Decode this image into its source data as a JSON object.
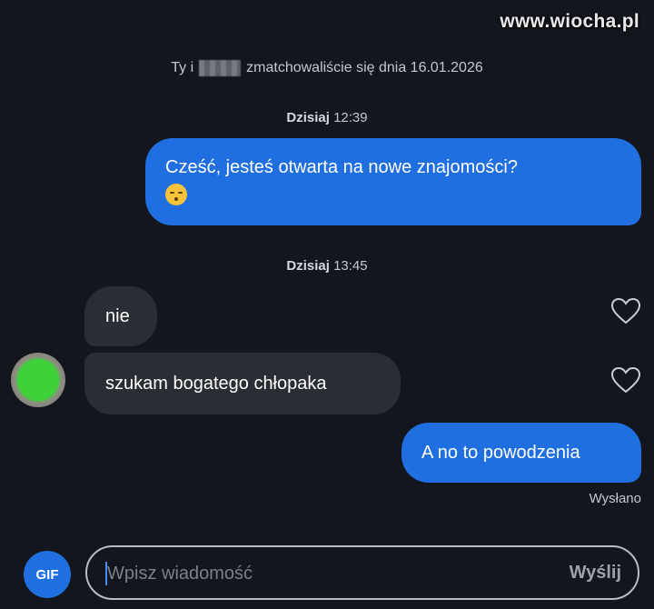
{
  "watermark": "www.wiocha.pl",
  "match_info": {
    "prefix": "Ty i",
    "suffix": "zmatchowaliście się dnia 16.01.2026"
  },
  "messages": [
    {
      "type": "timestamp",
      "day": "Dzisiaj",
      "time": "12:39"
    },
    {
      "type": "outgoing",
      "text": "Cześć, jesteś otwarta na nowe znajomości?",
      "emoji": "kissing-face-emoji"
    },
    {
      "type": "timestamp",
      "day": "Dzisiaj",
      "time": "13:45"
    },
    {
      "type": "incoming",
      "text": "nie"
    },
    {
      "type": "incoming",
      "text": "szukam bogatego chłopaka"
    },
    {
      "type": "outgoing",
      "text": "A no to powodzenia"
    }
  ],
  "status": "Wysłano",
  "composer": {
    "gif_label": "GIF",
    "placeholder": "Wpisz wiadomość",
    "send_label": "Wyślij"
  },
  "colors": {
    "background": "#13161c",
    "outgoing_bubble": "#1f6fe0",
    "incoming_bubble": "#2a2d33",
    "muted_text": "#c3c7cf"
  },
  "icons": [
    "heart-outline-icon",
    "avatar-blurred",
    "kissing-face-emoji"
  ]
}
